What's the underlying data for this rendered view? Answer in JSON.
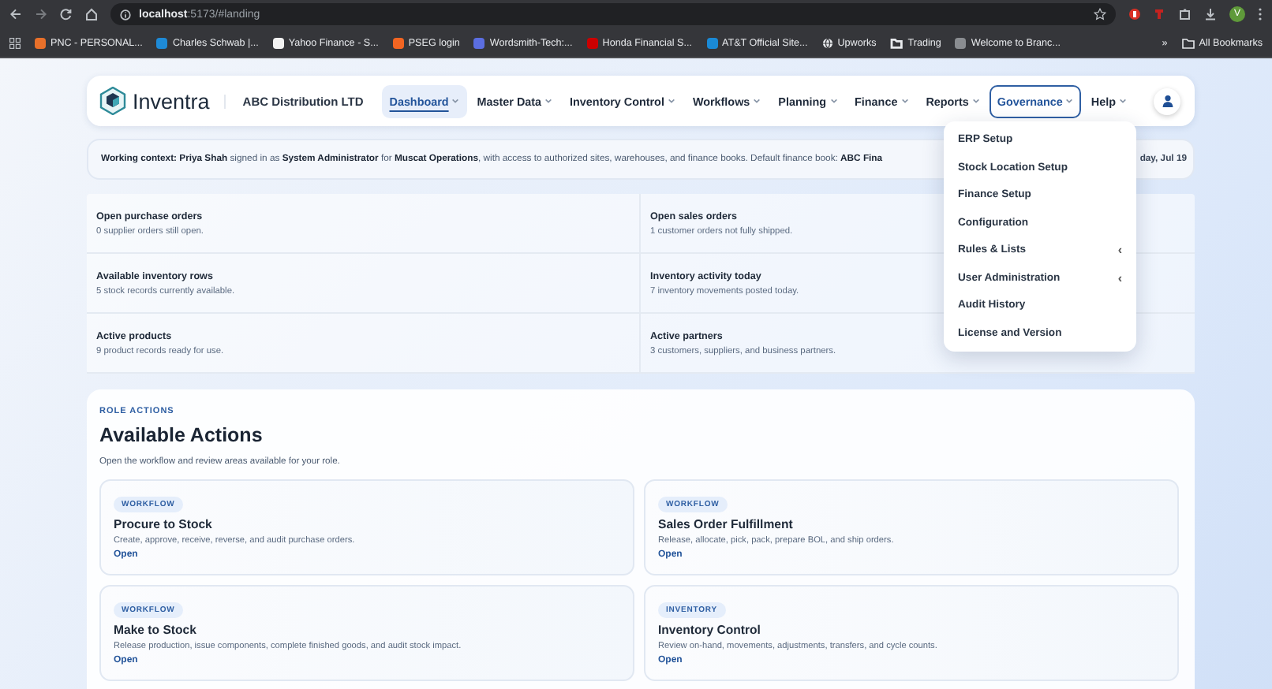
{
  "browser": {
    "url_host": "localhost",
    "url_path": ":5173/#landing",
    "profile_initial": "V",
    "bookmarks": [
      {
        "label": "PNC - PERSONAL...",
        "kind": "site",
        "color": "#e8702a"
      },
      {
        "label": "Charles Schwab |...",
        "kind": "site",
        "color": "#1e8ad6"
      },
      {
        "label": "Yahoo Finance - S...",
        "kind": "site",
        "color": "#f2f2f2"
      },
      {
        "label": "PSEG login",
        "kind": "site",
        "color": "#f26522"
      },
      {
        "label": "Wordsmith-Tech:...",
        "kind": "site",
        "color": "#5b6ee1"
      },
      {
        "label": "Honda Financial S...",
        "kind": "site",
        "color": "#cc0000"
      },
      {
        "label": "AT&T Official Site...",
        "kind": "site",
        "color": "#1a8ad6"
      },
      {
        "label": "Upworks",
        "kind": "globe",
        "color": "#e8eaed"
      },
      {
        "label": "Trading",
        "kind": "folder",
        "color": "#e8eaed"
      },
      {
        "label": "Welcome to Branc...",
        "kind": "site",
        "color": "#8a8d91"
      }
    ],
    "more": "»",
    "all_bookmarks": "All Bookmarks"
  },
  "header": {
    "brand": "Inventra",
    "company": "ABC Distribution LTD"
  },
  "nav": {
    "items": [
      {
        "label": "Dashboard",
        "selected": true,
        "expanded": false
      },
      {
        "label": "Master Data",
        "selected": false,
        "expanded": false
      },
      {
        "label": "Inventory Control",
        "selected": false,
        "expanded": false
      },
      {
        "label": "Workflows",
        "selected": false,
        "expanded": false
      },
      {
        "label": "Planning",
        "selected": false,
        "expanded": false
      },
      {
        "label": "Finance",
        "selected": false,
        "expanded": false
      },
      {
        "label": "Reports",
        "selected": false,
        "expanded": false
      },
      {
        "label": "Governance",
        "selected": false,
        "expanded": true
      },
      {
        "label": "Help",
        "selected": false,
        "expanded": false
      }
    ]
  },
  "context": {
    "text": "**Working context: Priya Shah** signed in as **System Administrator** for **Muscat Operations**, with access to authorized sites, warehouses, and finance books. Default finance book: **ABC Fina**",
    "date": "day, Jul 19"
  },
  "governance_menu": [
    {
      "label": "ERP Setup",
      "submenu": false
    },
    {
      "label": "Stock Location Setup",
      "submenu": false
    },
    {
      "label": "Finance Setup",
      "submenu": false
    },
    {
      "label": "Configuration",
      "submenu": false
    },
    {
      "label": "Rules & Lists",
      "submenu": true
    },
    {
      "label": "User Administration",
      "submenu": true
    },
    {
      "label": "Audit History",
      "submenu": false
    },
    {
      "label": "License and Version",
      "submenu": false
    }
  ],
  "submenu_glyph": "‹",
  "stats": [
    {
      "title": "Open purchase orders",
      "detail": "0 supplier orders still open."
    },
    {
      "title": "Open sales orders",
      "detail": "1 customer orders not fully shipped."
    },
    {
      "title": "Available inventory rows",
      "detail": "5 stock records currently available."
    },
    {
      "title": "Inventory activity today",
      "detail": "7 inventory movements posted today."
    },
    {
      "title": "Active products",
      "detail": "9 product records ready for use."
    },
    {
      "title": "Active partners",
      "detail": "3 customers, suppliers, and business partners."
    }
  ],
  "actions": {
    "eyebrow": "ROLE ACTIONS",
    "title": "Available Actions",
    "subtitle": "Open the workflow and review areas available for your role.",
    "cards": [
      {
        "tag": "WORKFLOW",
        "title": "Procure to Stock",
        "description": "Create, approve, receive, reverse, and audit purchase orders.",
        "link": "Open"
      },
      {
        "tag": "WORKFLOW",
        "title": "Sales Order Fulfillment",
        "description": "Release, allocate, pick, pack, prepare BOL, and ship orders.",
        "link": "Open"
      },
      {
        "tag": "WORKFLOW",
        "title": "Make to Stock",
        "description": "Release production, issue components, complete finished goods, and audit stock impact.",
        "link": "Open"
      },
      {
        "tag": "INVENTORY",
        "title": "Inventory Control",
        "description": "Review on-hand, movements, adjustments, transfers, and cycle counts.",
        "link": "Open"
      }
    ]
  }
}
